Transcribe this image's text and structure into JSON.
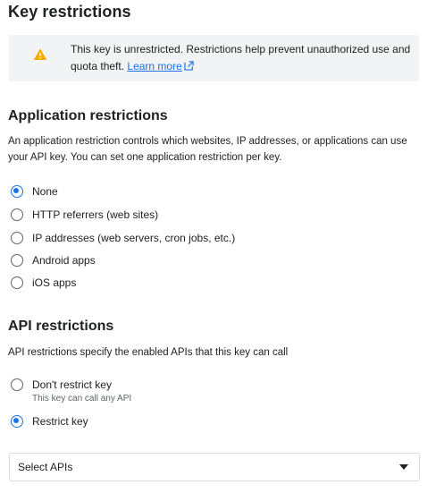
{
  "page_title": "Key restrictions",
  "warning": {
    "text": "This key is unrestricted. Restrictions help prevent unauthorized use and quota theft.",
    "link_text": "Learn more",
    "icon": "warning-icon",
    "icon_color": "#f9ab00"
  },
  "application_restrictions": {
    "title": "Application restrictions",
    "description": "An application restriction controls which websites, IP addresses, or applications can use your API key. You can set one application restriction per key.",
    "options": [
      {
        "label": "None",
        "checked": true
      },
      {
        "label": "HTTP referrers (web sites)",
        "checked": false
      },
      {
        "label": "IP addresses (web servers, cron jobs, etc.)",
        "checked": false
      },
      {
        "label": "Android apps",
        "checked": false
      },
      {
        "label": "iOS apps",
        "checked": false
      }
    ]
  },
  "api_restrictions": {
    "title": "API restrictions",
    "description": "API restrictions specify the enabled APIs that this key can call",
    "options": [
      {
        "label": "Don't restrict key",
        "sublabel": "This key can call any API",
        "checked": false
      },
      {
        "label": "Restrict key",
        "checked": true
      }
    ],
    "select": {
      "label": "Select APIs",
      "icon": "caret-down-icon"
    }
  },
  "colors": {
    "accent": "#1a73e8",
    "text": "#202124",
    "banner_bg": "#f1f3f4"
  }
}
